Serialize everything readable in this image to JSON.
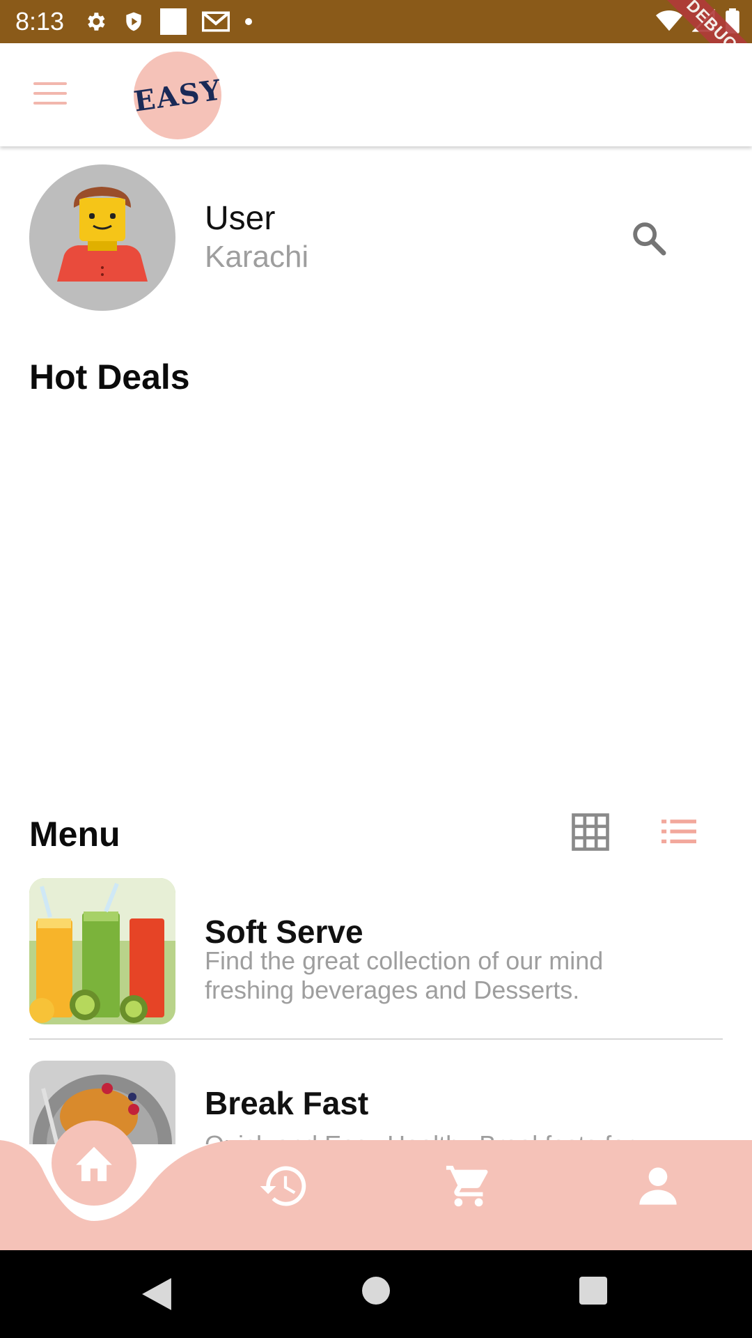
{
  "status_bar": {
    "time": "8:13",
    "left_icons": [
      "settings-icon",
      "shield-play-icon",
      "square-icon",
      "gmail-icon",
      "dot-icon"
    ],
    "right_icons": [
      "wifi-icon",
      "signal-icon",
      "battery-icon"
    ],
    "debug_label": "DEBUG",
    "background": "#8a5a19"
  },
  "app_bar": {
    "menu_icon": "hamburger-menu-icon",
    "logo_text": "EASY",
    "accent": "#f5c2b8"
  },
  "profile": {
    "name": "User",
    "city": "Karachi",
    "avatar_icon": "lego-man-avatar"
  },
  "sections": {
    "hot_deals": "Hot Deals",
    "menu": "Menu"
  },
  "menu_items": [
    {
      "title": "Soft Serve",
      "description": "Find the great collection of our mind freshing beverages and Desserts.",
      "image": "juice-glasses-image"
    },
    {
      "title": "Break Fast",
      "description": "Quick and Easy Healthy Breakfasts for",
      "image": "pancake-plate-image"
    }
  ],
  "bottom_nav": {
    "items": [
      "home-icon",
      "history-icon",
      "cart-icon",
      "person-icon"
    ],
    "background": "#f5c2b8"
  },
  "android_nav": [
    "back-button",
    "home-button",
    "recents-button"
  ]
}
